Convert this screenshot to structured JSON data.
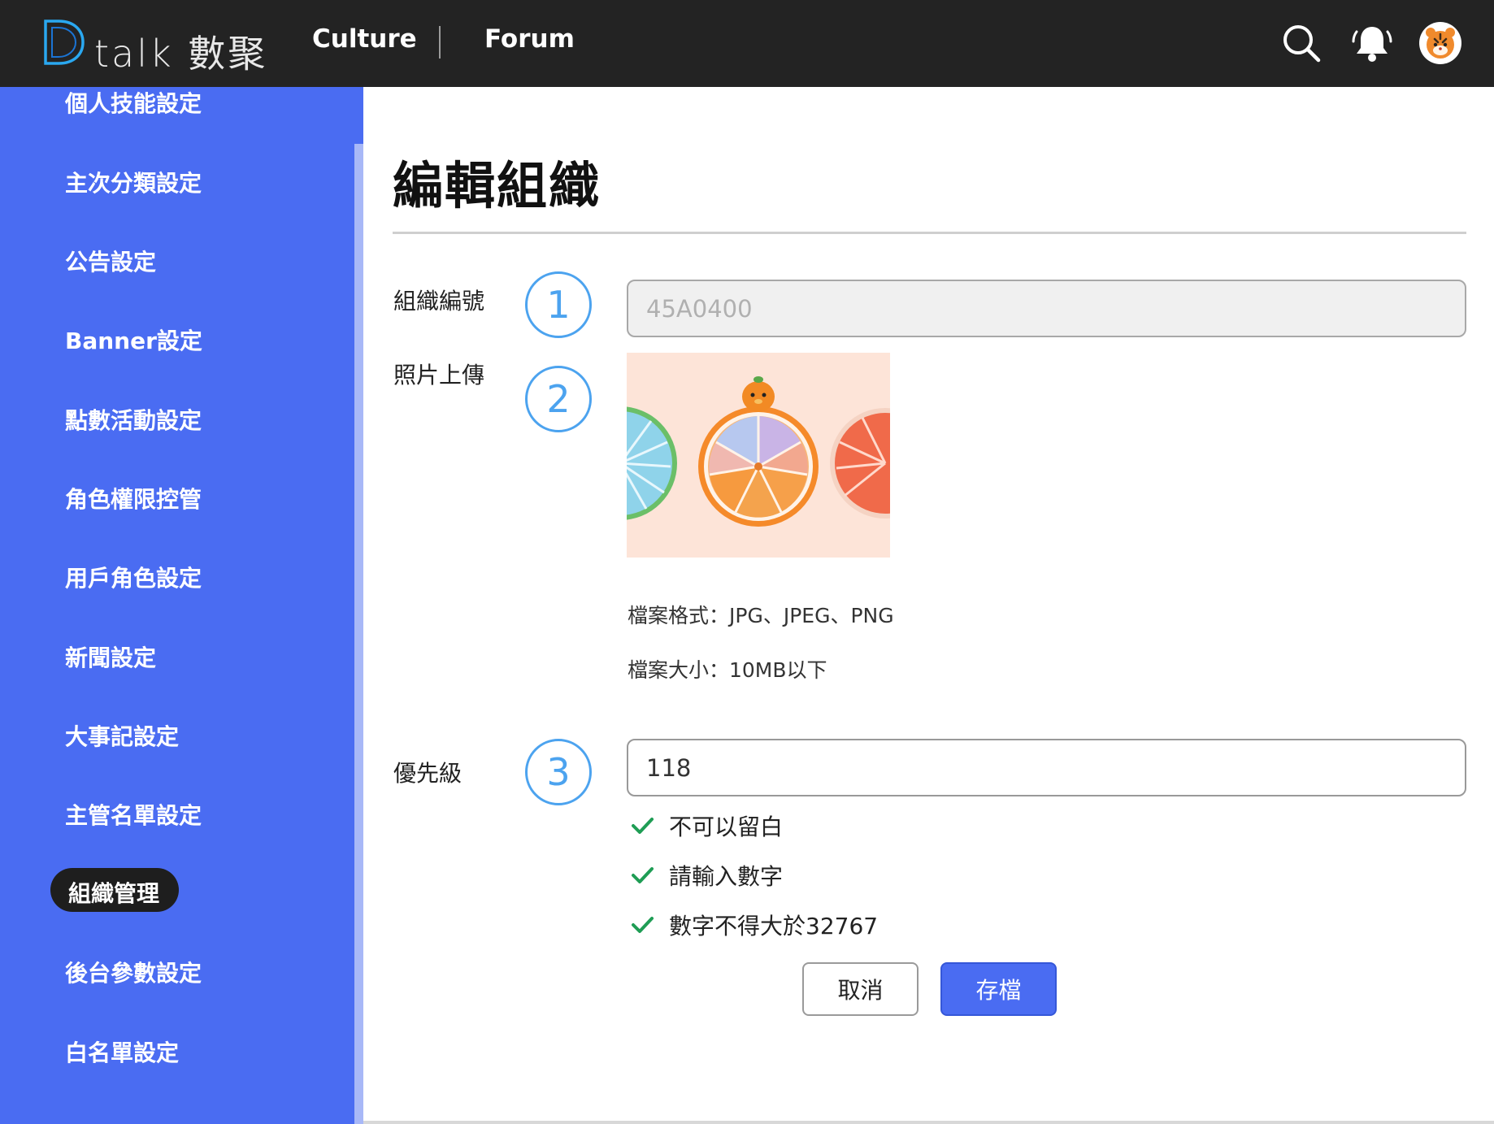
{
  "header": {
    "logo_text": "talk 數聚",
    "nav": [
      {
        "label": "Culture"
      },
      {
        "label": "Forum"
      }
    ],
    "icons": [
      "search-icon",
      "bell-icon",
      "user-avatar"
    ]
  },
  "sidebar": {
    "items": [
      {
        "label": "個人技能設定"
      },
      {
        "label": "主次分類設定"
      },
      {
        "label": "公告設定"
      },
      {
        "label": "Banner設定"
      },
      {
        "label": "點數活動設定"
      },
      {
        "label": "角色權限控管"
      },
      {
        "label": "用戶角色設定"
      },
      {
        "label": "新聞設定"
      },
      {
        "label": "大事記設定"
      },
      {
        "label": "主管名單設定"
      },
      {
        "label": "組織管理",
        "active": true
      },
      {
        "label": "後台參數設定"
      },
      {
        "label": "白名單設定"
      }
    ]
  },
  "main": {
    "title": "編輯組織",
    "fields": {
      "org_id": {
        "label": "組織編號",
        "step": "1",
        "value": "45A0400"
      },
      "photo": {
        "label": "照片上傳",
        "step": "2",
        "format_note": "檔案格式：JPG、JPEG、PNG",
        "size_note": "檔案大小：10MB以下"
      },
      "priority": {
        "label": "優先級",
        "step": "3",
        "value": "118"
      }
    },
    "validations": [
      {
        "text": "不可以留白",
        "ok": true
      },
      {
        "text": "請輸入數字",
        "ok": true
      },
      {
        "text": "數字不得大於32767",
        "ok": true
      }
    ],
    "buttons": {
      "cancel": "取消",
      "save": "存檔"
    }
  },
  "colors": {
    "topbar": "#232323",
    "sidebar": "#4a6cf2",
    "accent": "#4a6cf2",
    "step_circle": "#4ca3ef",
    "check": "#1f9d55"
  }
}
